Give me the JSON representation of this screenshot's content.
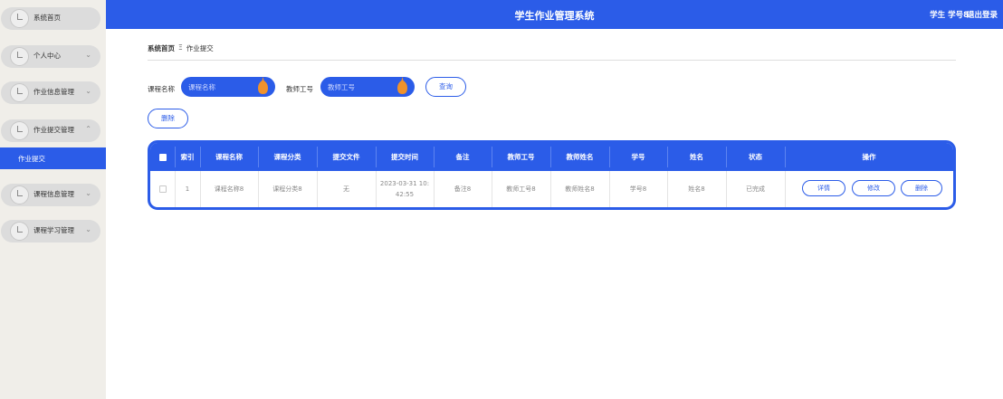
{
  "header": {
    "title": "学生作业管理系统",
    "user": "学生 学号8",
    "logout": "退出登录",
    "bg_color": "#2b5ce8"
  },
  "sidebar": {
    "items": [
      {
        "label": "系统首页",
        "icon": "clock-icon",
        "chevron": ""
      },
      {
        "label": "个人中心",
        "icon": "clock-icon",
        "chevron": "⌄"
      },
      {
        "label": "作业信息管理",
        "icon": "clock-icon",
        "chevron": "⌄"
      },
      {
        "label": "作业提交管理",
        "icon": "clock-icon",
        "chevron": "⌃"
      },
      {
        "label": "课程信息管理",
        "icon": "clock-icon",
        "chevron": "⌄"
      },
      {
        "label": "课程学习管理",
        "icon": "clock-icon",
        "chevron": "⌄"
      }
    ],
    "active_sub": "作业提交"
  },
  "breadcrumb": {
    "home": "系统首页",
    "separator": "Ξ",
    "current": "作业提交"
  },
  "search": {
    "course_label": "课程名称",
    "course_placeholder": "课程名称",
    "teacher_label": "教师工号",
    "teacher_placeholder": "教师工号",
    "query_button": "查询",
    "delete_button": "删除"
  },
  "table": {
    "headers": [
      "索引",
      "课程名称",
      "课程分类",
      "提交文件",
      "提交时间",
      "备注",
      "教师工号",
      "教师姓名",
      "学号",
      "姓名",
      "状态",
      "操作"
    ],
    "rows": [
      {
        "index": "1",
        "course_name": "课程名称8",
        "course_category": "课程分类8",
        "file": "无",
        "time_line1": "2023-03-31 10:",
        "time_line2": "42:55",
        "note": "备注8",
        "teacher_id": "教师工号8",
        "teacher_name": "教师姓名8",
        "student_id": "学号8",
        "name": "姓名8",
        "status": "已完成",
        "actions": {
          "detail": "详情",
          "edit": "修改",
          "delete": "删除"
        }
      }
    ]
  },
  "colors": {
    "accent": "#2b5ce8",
    "sidebar_bg": "#f0eee9",
    "pin": "#f0922b"
  }
}
